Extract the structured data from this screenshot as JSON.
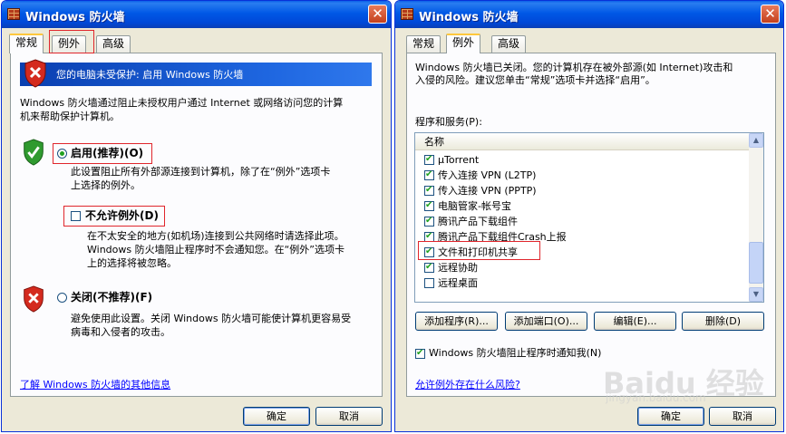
{
  "left_window": {
    "title": "Windows 防火墙",
    "close_label": "✕",
    "tabs": [
      "常规",
      "例外",
      "高级"
    ],
    "banner_text": "您的电脑未受保护: 启用 Windows 防火墙",
    "intro": [
      "Windows 防火墙通过阻止未授权用户通过 Internet 或网络访问您的计算",
      "机来帮助保护计算机。"
    ],
    "on_option": {
      "label": "启用(推荐)(O)",
      "desc": [
        "此设置阻止所有外部源连接到计算机，除了在“例外”选项卡",
        "上选择的例外。"
      ]
    },
    "no_exceptions": {
      "label": "不允许例外(D)",
      "checked": false,
      "desc": [
        "在不太安全的地方(如机场)连接到公共网络时请选择此项。",
        "Windows 防火墙阻止程序时不会通知您。在“例外”选项卡",
        "上的选择将被忽略。"
      ]
    },
    "off_option": {
      "label": "关闭(不推荐)(F)",
      "desc": [
        "避免使用此设置。关闭 Windows 防火墙可能使计算机更容易受",
        "病毒和入侵者的攻击。"
      ]
    },
    "more_link": "了解 Windows 防火墙的其他信息",
    "ok_label": "确定",
    "cancel_label": "取消"
  },
  "right_window": {
    "title": "Windows 防火墙",
    "close_label": "✕",
    "tabs": [
      "常规",
      "例外",
      "高级"
    ],
    "intro": [
      "Windows 防火墙已关闭。您的计算机存在被外部源(如 Internet)攻击和",
      "入侵的风险。建议您单击“常规”选项卡并选择“启用”。"
    ],
    "programs_label": "程序和服务(P):",
    "list_header": "名称",
    "items": [
      {
        "label": "µTorrent",
        "checked": true
      },
      {
        "label": "传入连接 VPN (L2TP)",
        "checked": true
      },
      {
        "label": "传入连接 VPN (PPTP)",
        "checked": true
      },
      {
        "label": "电脑管家-帐号宝",
        "checked": true
      },
      {
        "label": "腾讯产品下载组件",
        "checked": true
      },
      {
        "label": "腾讯产品下载组件Crash上报",
        "checked": true
      },
      {
        "label": "文件和打印机共享",
        "checked": true
      },
      {
        "label": "远程协助",
        "checked": true
      },
      {
        "label": "远程桌面",
        "checked": false
      }
    ],
    "buttons": {
      "add_program": "添加程序(R)...",
      "add_port": "添加端口(O)...",
      "edit": "编辑(E)...",
      "delete": "删除(D)"
    },
    "notify": {
      "label": "Windows 防火墙阻止程序时通知我(N)",
      "checked": true
    },
    "risk_link": "允许例外存在什么风险?",
    "ok_label": "确定",
    "cancel_label": "取消"
  },
  "watermark": {
    "text": "Baidu 经验",
    "sub": "jingyan.baidu.com"
  },
  "colors": {
    "title_blue": "#0058e6",
    "highlight_red": "#e0262c",
    "link_blue": "#0000ff",
    "check_green": "#21a121"
  }
}
